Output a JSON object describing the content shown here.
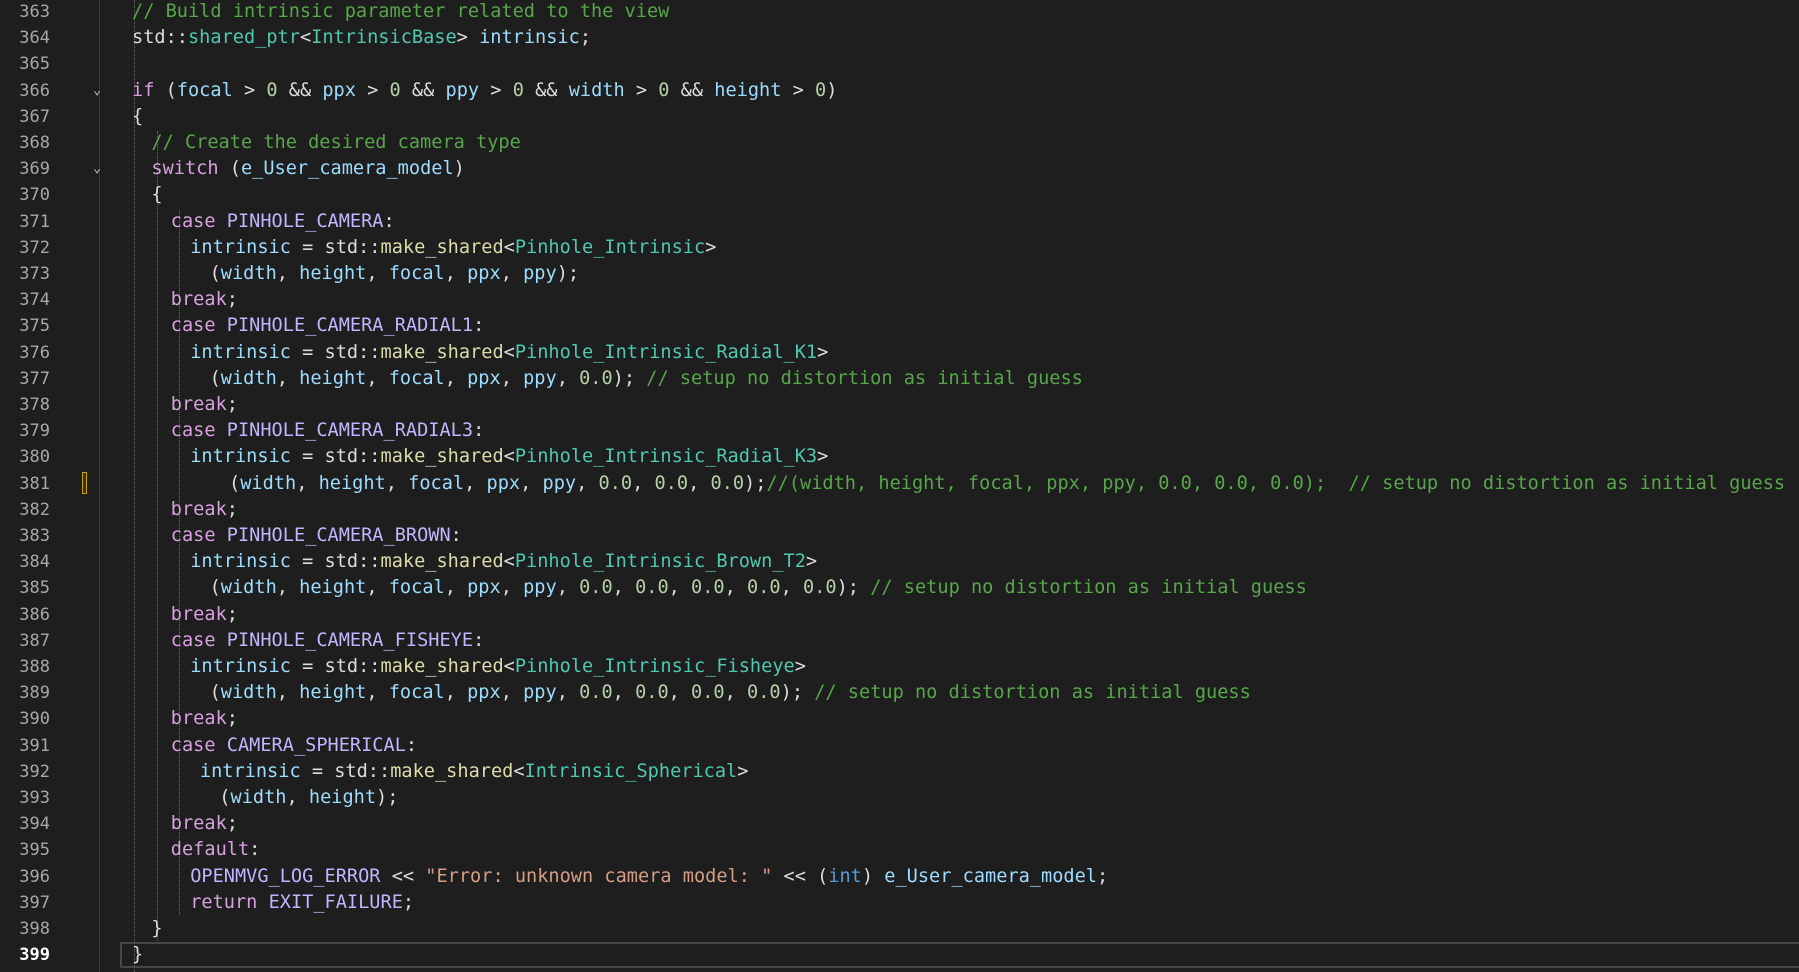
{
  "editor": {
    "current_line": 399,
    "bookmark_line": 381,
    "fold_lines": [
      366,
      369
    ],
    "lines": [
      {
        "n": "363",
        "indent": 0,
        "tokens": [
          [
            "cm",
            "// Build intrinsic parameter related to the view"
          ]
        ]
      },
      {
        "n": "364",
        "indent": 0,
        "tokens": [
          [
            "tx",
            "std::"
          ],
          [
            "ty",
            "shared_ptr"
          ],
          [
            "tx",
            "<"
          ],
          [
            "ty",
            "IntrinsicBase"
          ],
          [
            "tx",
            "> "
          ],
          [
            "vr",
            "intrinsic"
          ],
          [
            "tx",
            ";"
          ]
        ]
      },
      {
        "n": "365",
        "indent": 0,
        "tokens": []
      },
      {
        "n": "366",
        "indent": 0,
        "tokens": [
          [
            "kw",
            "if"
          ],
          [
            "tx",
            " ("
          ],
          [
            "vr",
            "focal"
          ],
          [
            "tx",
            " > "
          ],
          [
            "nm",
            "0"
          ],
          [
            "tx",
            " && "
          ],
          [
            "vr",
            "ppx"
          ],
          [
            "tx",
            " > "
          ],
          [
            "nm",
            "0"
          ],
          [
            "tx",
            " && "
          ],
          [
            "vr",
            "ppy"
          ],
          [
            "tx",
            " > "
          ],
          [
            "nm",
            "0"
          ],
          [
            "tx",
            " && "
          ],
          [
            "vr",
            "width"
          ],
          [
            "tx",
            " > "
          ],
          [
            "nm",
            "0"
          ],
          [
            "tx",
            " && "
          ],
          [
            "vr",
            "height"
          ],
          [
            "tx",
            " > "
          ],
          [
            "nm",
            "0"
          ],
          [
            "tx",
            ")"
          ]
        ]
      },
      {
        "n": "367",
        "indent": 0,
        "tokens": [
          [
            "tx",
            "{"
          ]
        ]
      },
      {
        "n": "368",
        "indent": 2,
        "tokens": [
          [
            "cm",
            "// Create the desired camera type"
          ]
        ]
      },
      {
        "n": "369",
        "indent": 2,
        "tokens": [
          [
            "kw",
            "switch"
          ],
          [
            "tx",
            " ("
          ],
          [
            "vr",
            "e_User_camera_model"
          ],
          [
            "tx",
            ")"
          ]
        ]
      },
      {
        "n": "370",
        "indent": 2,
        "tokens": [
          [
            "tx",
            "{"
          ]
        ]
      },
      {
        "n": "371",
        "indent": 4,
        "tokens": [
          [
            "kw",
            "case"
          ],
          [
            "tx",
            " "
          ],
          [
            "mc",
            "PINHOLE_CAMERA"
          ],
          [
            "tx",
            ":"
          ]
        ]
      },
      {
        "n": "372",
        "indent": 6,
        "tokens": [
          [
            "vr",
            "intrinsic"
          ],
          [
            "tx",
            " = std::"
          ],
          [
            "fn",
            "make_shared"
          ],
          [
            "tx",
            "<"
          ],
          [
            "ty",
            "Pinhole_Intrinsic"
          ],
          [
            "tx",
            ">"
          ]
        ]
      },
      {
        "n": "373",
        "indent": 8,
        "tokens": [
          [
            "tx",
            "("
          ],
          [
            "vr",
            "width"
          ],
          [
            "tx",
            ", "
          ],
          [
            "vr",
            "height"
          ],
          [
            "tx",
            ", "
          ],
          [
            "vr",
            "focal"
          ],
          [
            "tx",
            ", "
          ],
          [
            "vr",
            "ppx"
          ],
          [
            "tx",
            ", "
          ],
          [
            "vr",
            "ppy"
          ],
          [
            "tx",
            ");"
          ]
        ]
      },
      {
        "n": "374",
        "indent": 4,
        "tokens": [
          [
            "kw",
            "break"
          ],
          [
            "tx",
            ";"
          ]
        ]
      },
      {
        "n": "375",
        "indent": 4,
        "tokens": [
          [
            "kw",
            "case"
          ],
          [
            "tx",
            " "
          ],
          [
            "mc",
            "PINHOLE_CAMERA_RADIAL1"
          ],
          [
            "tx",
            ":"
          ]
        ]
      },
      {
        "n": "376",
        "indent": 6,
        "tokens": [
          [
            "vr",
            "intrinsic"
          ],
          [
            "tx",
            " = std::"
          ],
          [
            "fn",
            "make_shared"
          ],
          [
            "tx",
            "<"
          ],
          [
            "ty",
            "Pinhole_Intrinsic_Radial_K1"
          ],
          [
            "tx",
            ">"
          ]
        ]
      },
      {
        "n": "377",
        "indent": 8,
        "tokens": [
          [
            "tx",
            "("
          ],
          [
            "vr",
            "width"
          ],
          [
            "tx",
            ", "
          ],
          [
            "vr",
            "height"
          ],
          [
            "tx",
            ", "
          ],
          [
            "vr",
            "focal"
          ],
          [
            "tx",
            ", "
          ],
          [
            "vr",
            "ppx"
          ],
          [
            "tx",
            ", "
          ],
          [
            "vr",
            "ppy"
          ],
          [
            "tx",
            ", "
          ],
          [
            "nm",
            "0.0"
          ],
          [
            "tx",
            "); "
          ],
          [
            "cm",
            "// setup no distortion as initial guess"
          ]
        ]
      },
      {
        "n": "378",
        "indent": 4,
        "tokens": [
          [
            "kw",
            "break"
          ],
          [
            "tx",
            ";"
          ]
        ]
      },
      {
        "n": "379",
        "indent": 4,
        "tokens": [
          [
            "kw",
            "case"
          ],
          [
            "tx",
            " "
          ],
          [
            "mc",
            "PINHOLE_CAMERA_RADIAL3"
          ],
          [
            "tx",
            ":"
          ]
        ]
      },
      {
        "n": "380",
        "indent": 6,
        "tokens": [
          [
            "vr",
            "intrinsic"
          ],
          [
            "tx",
            " = std::"
          ],
          [
            "fn",
            "make_shared"
          ],
          [
            "tx",
            "<"
          ],
          [
            "ty",
            "Pinhole_Intrinsic_Radial_K3"
          ],
          [
            "tx",
            ">"
          ]
        ]
      },
      {
        "n": "381",
        "indent": 10,
        "tokens": [
          [
            "tx",
            "("
          ],
          [
            "vr",
            "width"
          ],
          [
            "tx",
            ", "
          ],
          [
            "vr",
            "height"
          ],
          [
            "tx",
            ", "
          ],
          [
            "vr",
            "focal"
          ],
          [
            "tx",
            ", "
          ],
          [
            "vr",
            "ppx"
          ],
          [
            "tx",
            ", "
          ],
          [
            "vr",
            "ppy"
          ],
          [
            "tx",
            ", "
          ],
          [
            "nm",
            "0.0"
          ],
          [
            "tx",
            ", "
          ],
          [
            "nm",
            "0.0"
          ],
          [
            "tx",
            ", "
          ],
          [
            "nm",
            "0.0"
          ],
          [
            "tx",
            ");"
          ],
          [
            "cm",
            "//(width, height, focal, ppx, ppy, 0.0, 0.0, 0.0);  // setup no distortion as initial guess"
          ]
        ]
      },
      {
        "n": "382",
        "indent": 4,
        "tokens": [
          [
            "kw",
            "break"
          ],
          [
            "tx",
            ";"
          ]
        ]
      },
      {
        "n": "383",
        "indent": 4,
        "tokens": [
          [
            "kw",
            "case"
          ],
          [
            "tx",
            " "
          ],
          [
            "mc",
            "PINHOLE_CAMERA_BROWN"
          ],
          [
            "tx",
            ":"
          ]
        ]
      },
      {
        "n": "384",
        "indent": 6,
        "tokens": [
          [
            "vr",
            "intrinsic"
          ],
          [
            "tx",
            " = std::"
          ],
          [
            "fn",
            "make_shared"
          ],
          [
            "tx",
            "<"
          ],
          [
            "ty",
            "Pinhole_Intrinsic_Brown_T2"
          ],
          [
            "tx",
            ">"
          ]
        ]
      },
      {
        "n": "385",
        "indent": 8,
        "tokens": [
          [
            "tx",
            "("
          ],
          [
            "vr",
            "width"
          ],
          [
            "tx",
            ", "
          ],
          [
            "vr",
            "height"
          ],
          [
            "tx",
            ", "
          ],
          [
            "vr",
            "focal"
          ],
          [
            "tx",
            ", "
          ],
          [
            "vr",
            "ppx"
          ],
          [
            "tx",
            ", "
          ],
          [
            "vr",
            "ppy"
          ],
          [
            "tx",
            ", "
          ],
          [
            "nm",
            "0.0"
          ],
          [
            "tx",
            ", "
          ],
          [
            "nm",
            "0.0"
          ],
          [
            "tx",
            ", "
          ],
          [
            "nm",
            "0.0"
          ],
          [
            "tx",
            ", "
          ],
          [
            "nm",
            "0.0"
          ],
          [
            "tx",
            ", "
          ],
          [
            "nm",
            "0.0"
          ],
          [
            "tx",
            "); "
          ],
          [
            "cm",
            "// setup no distortion as initial guess"
          ]
        ]
      },
      {
        "n": "386",
        "indent": 4,
        "tokens": [
          [
            "kw",
            "break"
          ],
          [
            "tx",
            ";"
          ]
        ]
      },
      {
        "n": "387",
        "indent": 4,
        "tokens": [
          [
            "kw",
            "case"
          ],
          [
            "tx",
            " "
          ],
          [
            "mc",
            "PINHOLE_CAMERA_FISHEYE"
          ],
          [
            "tx",
            ":"
          ]
        ]
      },
      {
        "n": "388",
        "indent": 6,
        "tokens": [
          [
            "vr",
            "intrinsic"
          ],
          [
            "tx",
            " = std::"
          ],
          [
            "fn",
            "make_shared"
          ],
          [
            "tx",
            "<"
          ],
          [
            "ty",
            "Pinhole_Intrinsic_Fisheye"
          ],
          [
            "tx",
            ">"
          ]
        ]
      },
      {
        "n": "389",
        "indent": 8,
        "tokens": [
          [
            "tx",
            "("
          ],
          [
            "vr",
            "width"
          ],
          [
            "tx",
            ", "
          ],
          [
            "vr",
            "height"
          ],
          [
            "tx",
            ", "
          ],
          [
            "vr",
            "focal"
          ],
          [
            "tx",
            ", "
          ],
          [
            "vr",
            "ppx"
          ],
          [
            "tx",
            ", "
          ],
          [
            "vr",
            "ppy"
          ],
          [
            "tx",
            ", "
          ],
          [
            "nm",
            "0.0"
          ],
          [
            "tx",
            ", "
          ],
          [
            "nm",
            "0.0"
          ],
          [
            "tx",
            ", "
          ],
          [
            "nm",
            "0.0"
          ],
          [
            "tx",
            ", "
          ],
          [
            "nm",
            "0.0"
          ],
          [
            "tx",
            "); "
          ],
          [
            "cm",
            "// setup no distortion as initial guess"
          ]
        ]
      },
      {
        "n": "390",
        "indent": 4,
        "tokens": [
          [
            "kw",
            "break"
          ],
          [
            "tx",
            ";"
          ]
        ]
      },
      {
        "n": "391",
        "indent": 4,
        "tokens": [
          [
            "kw",
            "case"
          ],
          [
            "tx",
            " "
          ],
          [
            "mc",
            "CAMERA_SPHERICAL"
          ],
          [
            "tx",
            ":"
          ]
        ]
      },
      {
        "n": "392",
        "indent": 7,
        "tokens": [
          [
            "vr",
            "intrinsic"
          ],
          [
            "tx",
            " = std::"
          ],
          [
            "fn",
            "make_shared"
          ],
          [
            "tx",
            "<"
          ],
          [
            "ty",
            "Intrinsic_Spherical"
          ],
          [
            "tx",
            ">"
          ]
        ]
      },
      {
        "n": "393",
        "indent": 9,
        "tokens": [
          [
            "tx",
            "("
          ],
          [
            "vr",
            "width"
          ],
          [
            "tx",
            ", "
          ],
          [
            "vr",
            "height"
          ],
          [
            "tx",
            ");"
          ]
        ]
      },
      {
        "n": "394",
        "indent": 4,
        "tokens": [
          [
            "kw",
            "break"
          ],
          [
            "tx",
            ";"
          ]
        ]
      },
      {
        "n": "395",
        "indent": 4,
        "tokens": [
          [
            "kw",
            "default"
          ],
          [
            "tx",
            ":"
          ]
        ]
      },
      {
        "n": "396",
        "indent": 6,
        "tokens": [
          [
            "mc",
            "OPENMVG_LOG_ERROR"
          ],
          [
            "tx",
            " << "
          ],
          [
            "st",
            "\"Error: unknown camera model: \""
          ],
          [
            "tx",
            " << ("
          ],
          [
            "kb",
            "int"
          ],
          [
            "tx",
            ") "
          ],
          [
            "vr",
            "e_User_camera_model"
          ],
          [
            "tx",
            ";"
          ]
        ]
      },
      {
        "n": "397",
        "indent": 6,
        "tokens": [
          [
            "kw",
            "return"
          ],
          [
            "tx",
            " "
          ],
          [
            "mc",
            "EXIT_FAILURE"
          ],
          [
            "tx",
            ";"
          ]
        ]
      },
      {
        "n": "398",
        "indent": 2,
        "tokens": [
          [
            "tx",
            "}"
          ]
        ]
      },
      {
        "n": "399",
        "indent": 0,
        "tokens": [
          [
            "tx",
            "}"
          ]
        ]
      }
    ]
  }
}
